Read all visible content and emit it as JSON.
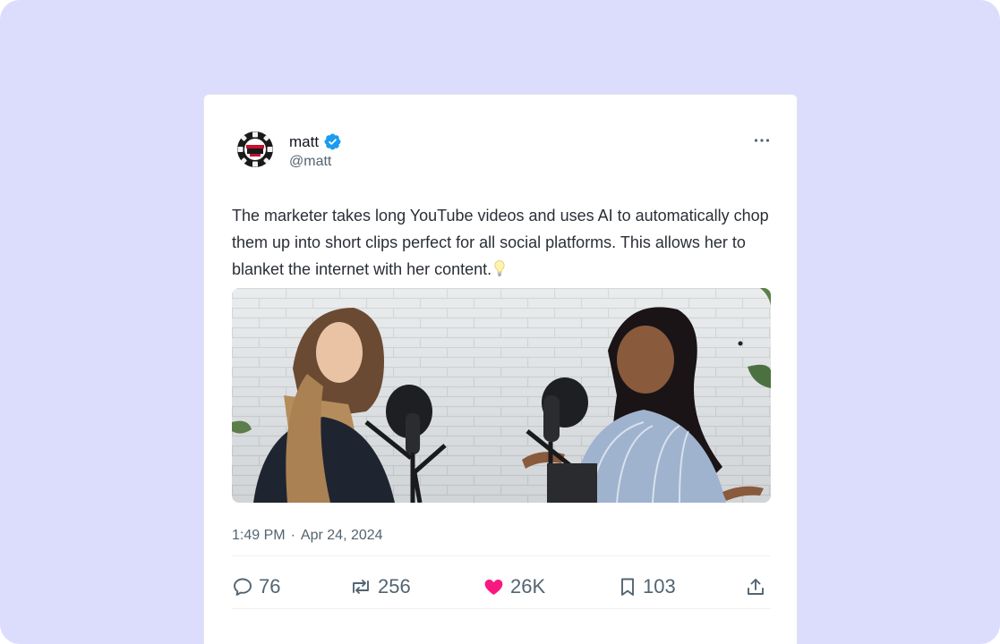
{
  "tweet": {
    "author": {
      "name": "matt",
      "handle": "@matt",
      "avatar_icon": "poker-chip-icon",
      "verified": true
    },
    "text": "The marketer takes long YouTube videos and uses AI to automatically chop them up into short clips perfect for all social platforms. This allows her to blanket the internet with her content.",
    "text_emoji": "lightbulb-icon",
    "media": {
      "kind": "photo",
      "subject": "two women speaking into podcast microphones in front of a white brick wall"
    },
    "time": "1:49 PM",
    "separator": "·",
    "date": "Apr 24, 2024",
    "stats": {
      "replies": "76",
      "retweets": "256",
      "likes": "26K",
      "bookmarks": "103"
    }
  },
  "colors": {
    "background": "#dcdcfc",
    "card": "#ffffff",
    "text": "#2a2f36",
    "muted": "#536471",
    "verified": "#1d9bf0",
    "like": "#f91880"
  }
}
